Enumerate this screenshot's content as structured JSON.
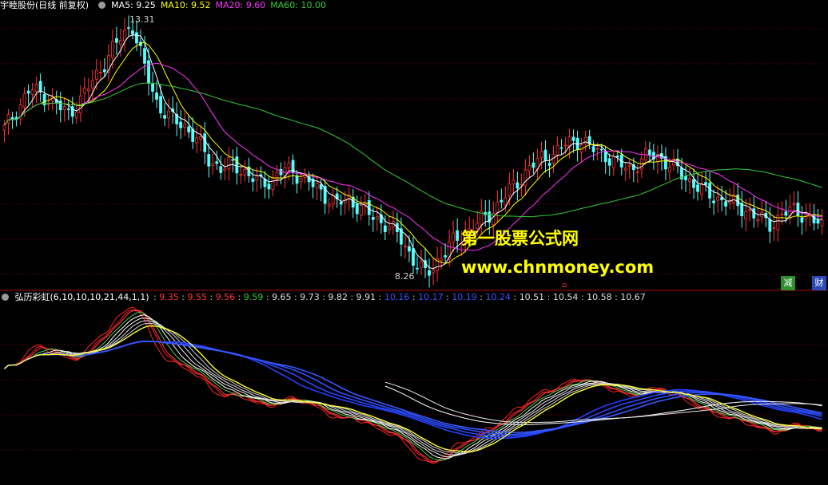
{
  "header": {
    "stock_name": "宇睦股份(日线 前复权)",
    "ma_items": [
      {
        "label": "MA5: 9.25",
        "color": "#ffffff"
      },
      {
        "label": "MA10: 9.52",
        "color": "#ffff00"
      },
      {
        "label": "MA20: 9.60",
        "color": "#ff33ff"
      },
      {
        "label": "MA60: 10.00",
        "color": "#33cc33"
      }
    ]
  },
  "price_panel": {
    "high_label": "13.31",
    "low_label": "8.26",
    "colors": {
      "up": "#ff3333",
      "down": "#54ffff",
      "ma5": "#ffffff",
      "ma10": "#ffff00",
      "ma20": "#ff33ff",
      "ma60": "#33cc33",
      "grid": "#8b0000"
    }
  },
  "watermark": {
    "line1": "第一股票公式网",
    "line2": "www.chnmoney.com"
  },
  "tags": {
    "jian": "减",
    "cai": "财"
  },
  "indicator": {
    "name": "弘历彩虹(6,10,10,10,21,44,1,1)",
    "values": [
      {
        "v": "9.35",
        "color": "#ff3333"
      },
      {
        "v": "9.55",
        "color": "#ff3333"
      },
      {
        "v": "9.56",
        "color": "#ff3333"
      },
      {
        "v": "9.59",
        "color": "#33cc33"
      },
      {
        "v": "9.65",
        "color": "#dddddd"
      },
      {
        "v": "9.73",
        "color": "#dddddd"
      },
      {
        "v": "9.82",
        "color": "#dddddd"
      },
      {
        "v": "9.91",
        "color": "#dddddd"
      },
      {
        "v": "10.16",
        "color": "#3355ff"
      },
      {
        "v": "10.17",
        "color": "#3355ff"
      },
      {
        "v": "10.19",
        "color": "#3355ff"
      },
      {
        "v": "10.24",
        "color": "#3355ff"
      },
      {
        "v": "10.51",
        "color": "#dddddd"
      },
      {
        "v": "10.54",
        "color": "#dddddd"
      },
      {
        "v": "10.58",
        "color": "#dddddd"
      },
      {
        "v": "10.67",
        "color": "#dddddd"
      }
    ]
  },
  "chart_data": {
    "type": "candlestick",
    "title": "",
    "price_high": 13.31,
    "price_low": 8.26,
    "ylim": [
      8.0,
      13.5
    ],
    "close_path": [
      11.2,
      11.6,
      12.0,
      11.9,
      11.7,
      11.5,
      11.8,
      12.2,
      12.6,
      13.0,
      13.31,
      12.4,
      11.7,
      11.4,
      11.3,
      11.0,
      10.6,
      10.4,
      10.5,
      10.3,
      10.1,
      10.2,
      10.4,
      10.3,
      10.1,
      9.9,
      9.7,
      9.8,
      9.6,
      9.4,
      9.3,
      9.0,
      8.6,
      8.26,
      8.6,
      8.9,
      9.1,
      9.3,
      9.5,
      9.8,
      10.1,
      10.4,
      10.6,
      10.7,
      10.9,
      11.0,
      10.8,
      10.7,
      10.5,
      10.4,
      10.6,
      10.7,
      10.5,
      10.3,
      10.1,
      9.9,
      9.8,
      9.7,
      9.6,
      9.4,
      9.3,
      9.5,
      9.6,
      9.4,
      9.25
    ]
  }
}
